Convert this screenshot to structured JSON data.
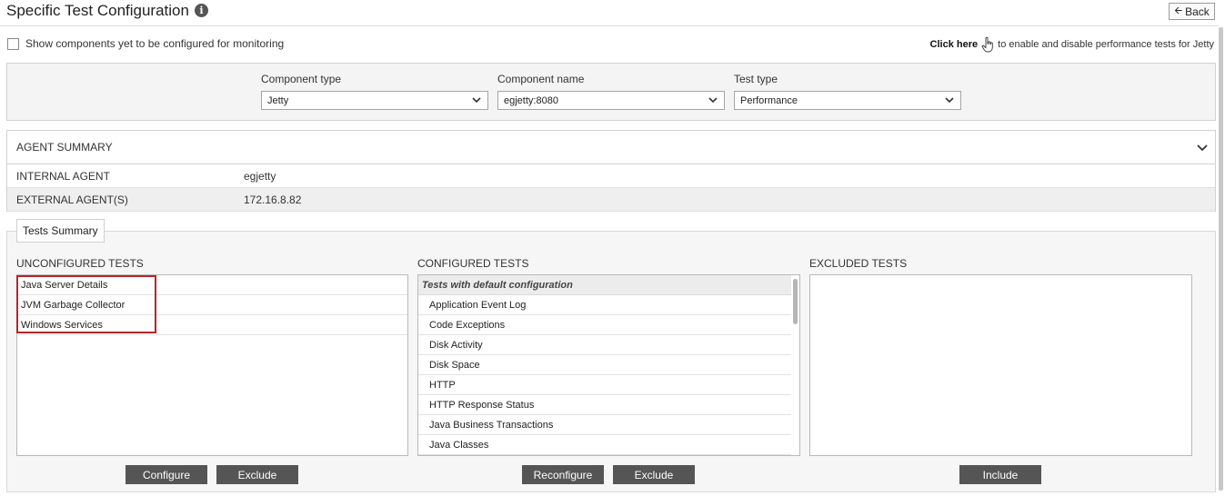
{
  "header": {
    "title": "Specific Test Configuration",
    "info_glyph": "i",
    "back_label": "Back"
  },
  "options": {
    "show_unconfigured_label": "Show components yet to be configured for monitoring",
    "show_unconfigured_checked": false,
    "click_here_label": "Click here",
    "click_here_suffix": "to enable and disable performance tests for Jetty"
  },
  "filters": {
    "component_type": {
      "label": "Component type",
      "value": "Jetty"
    },
    "component_name": {
      "label": "Component name",
      "value": "egjetty:8080"
    },
    "test_type": {
      "label": "Test type",
      "value": "Performance"
    }
  },
  "agent_summary": {
    "title": "AGENT SUMMARY",
    "rows": [
      {
        "key": "INTERNAL AGENT",
        "value": "egjetty"
      },
      {
        "key": "EXTERNAL AGENT(S)",
        "value": "172.16.8.82"
      }
    ]
  },
  "tests_summary": {
    "tab_label": "Tests Summary",
    "unconfigured": {
      "title": "UNCONFIGURED TESTS",
      "items": [
        "Java Server Details",
        "JVM Garbage Collector",
        "Windows Services"
      ]
    },
    "configured": {
      "title": "CONFIGURED TESTS",
      "group_label": "Tests with default configuration",
      "items": [
        "Application Event Log",
        "Code Exceptions",
        "Disk Activity",
        "Disk Space",
        "HTTP",
        "HTTP Response Status",
        "Java Business Transactions",
        "Java Classes"
      ]
    },
    "excluded": {
      "title": "EXCLUDED TESTS",
      "items": []
    }
  },
  "buttons": {
    "configure": "Configure",
    "exclude_unconfigured": "Exclude",
    "reconfigure": "Reconfigure",
    "exclude_configured": "Exclude",
    "include": "Include"
  },
  "colors": {
    "button_bg": "#555555",
    "highlight_border": "#b3262c",
    "panel_bg": "#f4f4f4"
  }
}
